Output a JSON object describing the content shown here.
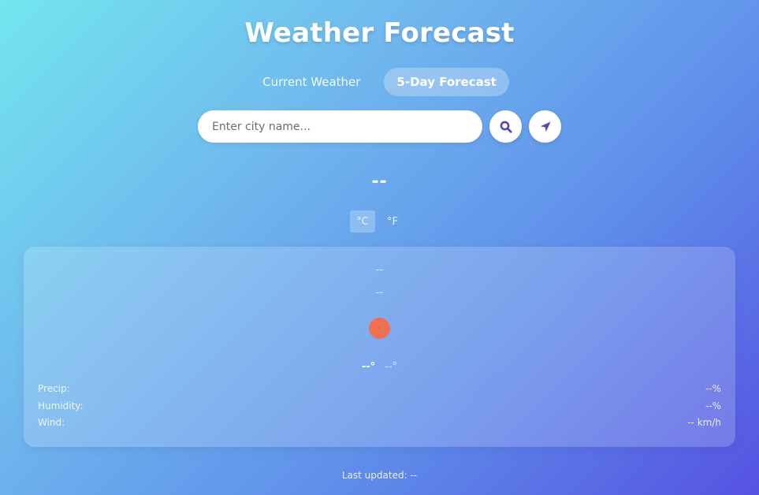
{
  "app": {
    "title": "Weather Forecast"
  },
  "tabs": [
    {
      "label": "Current Weather",
      "active": false
    },
    {
      "label": "5-Day Forecast",
      "active": true
    }
  ],
  "search": {
    "placeholder": "Enter city name...",
    "value": "",
    "search_icon": "search-icon",
    "locate_icon": "location-arrow-icon"
  },
  "location": {
    "city": "--"
  },
  "units": {
    "celsius": "°C",
    "fahrenheit": "°F",
    "selected": "celsius"
  },
  "forecast_card": {
    "day": "--",
    "date": "--",
    "icon": "sun-icon",
    "temp_high": "--°",
    "temp_low": "--°",
    "precip_label": "Precip:",
    "precip_value": "--%",
    "humidity_label": "Humidity:",
    "humidity_value": "--%",
    "wind_label": "Wind:",
    "wind_value": "-- km/h"
  },
  "footer": {
    "last_updated": "Last updated: --"
  },
  "colors": {
    "accent": "#5553e2",
    "sun": "#ef6f52",
    "icon": "#4c4bb8"
  }
}
